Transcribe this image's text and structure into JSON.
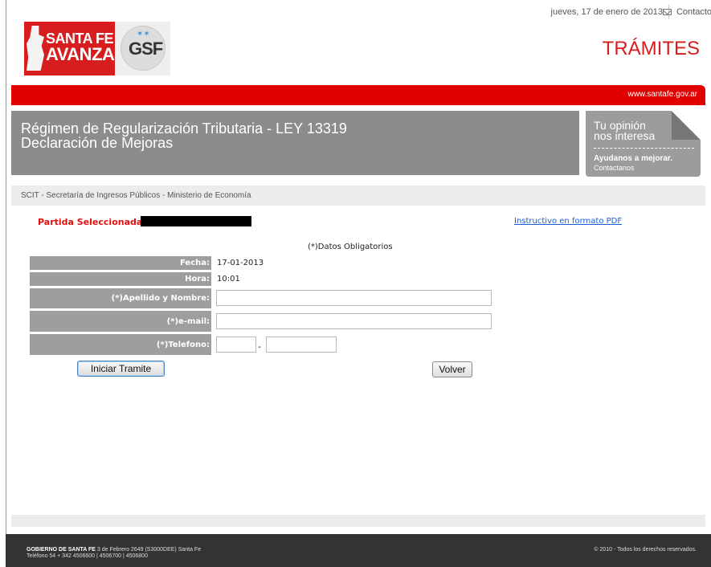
{
  "header": {
    "date": "jueves, 17 de enero de 2013",
    "contact_label": "Contacto",
    "logo_line1": "SANTA FE",
    "logo_line2": "AVANZA",
    "gsf_logo": "GSF",
    "section_title": "TRÁMITES",
    "site_url": "www.santafe.gov.ar"
  },
  "banner": {
    "title_line1": "Régimen de Regularización Tributaria - LEY 13319",
    "title_line2": "Declaración de Mejoras"
  },
  "opinion_box": {
    "line1": "Tu opinión",
    "line2": "nos interesa",
    "cta": "Ayudanos a mejorar.",
    "link": "Contactanos"
  },
  "breadcrumb": "SCIT - Secretaría de Ingresos Públicos - Ministerio de Economía",
  "partida": {
    "label": "Partida Seleccionada:",
    "value": ""
  },
  "pdf_link": "Instructivo en formato PDF",
  "form": {
    "required_note": "(*)Datos Obligatorios",
    "fecha_label": "Fecha:",
    "fecha_value": "17-01-2013",
    "hora_label": "Hora:",
    "hora_value": "10:01",
    "nombre_label": "(*)Apellido y Nombre:",
    "nombre_value": "",
    "email_label": "(*)e-mail:",
    "email_value": "",
    "telefono_label": "(*)Telefono:",
    "telefono_area": "",
    "telefono_numero": "",
    "telefono_sep": "-",
    "submit_label": "Iniciar Tramite",
    "back_label": "Volver"
  },
  "footer": {
    "org": "GOBIERNO DE SANTA FE",
    "address": "3 de Febrero 2649 (S3000DEE) Santa Fe",
    "phones": "Teléfono 54 + 342 4506600 | 4506700 | 4506800",
    "copyright": "© 2010 - Todos los derechos reservados."
  },
  "colors": {
    "brand_red": "#e00000",
    "banner_gray": "#8c8c8c",
    "label_gray": "#9e9e9e",
    "footer_dark": "#333333"
  }
}
